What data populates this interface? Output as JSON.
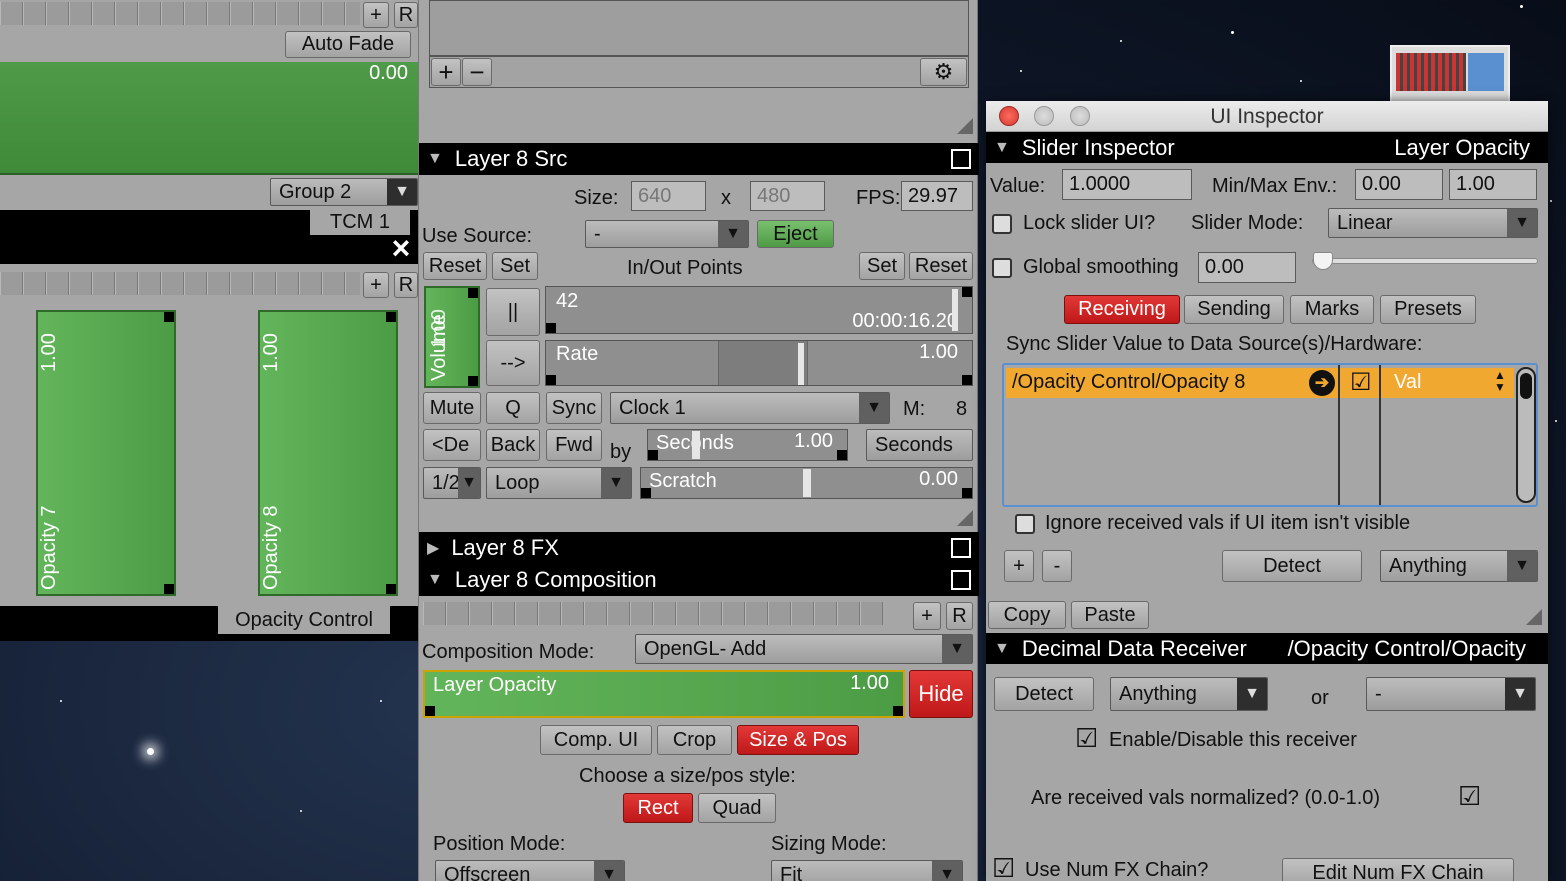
{
  "left_panel": {
    "add_button": "+",
    "r_button": "R",
    "auto_fade_button": "Auto Fade",
    "fade_value": "0.00",
    "group_select": "Group 2",
    "tcm_label": "TCM 1",
    "close_icon": "×",
    "opacity7": {
      "value": "1.00",
      "label": "Opacity 7"
    },
    "opacity8": {
      "value": "1.00",
      "label": "Opacity 8"
    },
    "opacity_control_label": "Opacity Control"
  },
  "mid_panel": {
    "top_plus": "+",
    "top_minus": "−",
    "gear_icon": "⚙",
    "src_header": "Layer 8 Src",
    "size_label": "Size:",
    "size_w": "640",
    "size_x": "x",
    "size_h": "480",
    "fps_label": "FPS:",
    "fps_value": "29.97",
    "use_source_label": "Use Source:",
    "source_value": "-",
    "eject_button": "Eject",
    "reset_left": "Reset",
    "set_left": "Set",
    "in_out_label": "In/Out Points",
    "set_right": "Set",
    "reset_right": "Reset",
    "volume_label": "Volume",
    "volume_value": "1.00",
    "pause_button": "||",
    "forward_button": "-->",
    "frame_value": "42",
    "timecode": "00:00:16.20",
    "rate_label": "Rate",
    "rate_value": "1.00",
    "mute_button": "Mute",
    "q_button": "Q",
    "sync_button": "Sync",
    "clock_select": "Clock 1",
    "m_label": "M:",
    "m_value": "8",
    "del_button": "<De",
    "back_button": "Back",
    "fwd_button": "Fwd",
    "by_label": "by",
    "seconds_slider_label": "Seconds",
    "seconds_slider_value": "1.00",
    "seconds_select": "Seconds",
    "half_select": "1/2",
    "loop_select": "Loop",
    "scratch_label": "Scratch",
    "scratch_value": "0.00",
    "fx_header": "Layer 8 FX",
    "comp_header": "Layer 8 Composition",
    "comp_plus": "+",
    "comp_r": "R",
    "composition_mode_label": "Composition Mode:",
    "composition_mode_value": "OpenGL- Add",
    "layer_opacity_label": "Layer Opacity",
    "layer_opacity_value": "1.00",
    "hide_button": "Hide",
    "comp_ui_button": "Comp. UI",
    "crop_button": "Crop",
    "size_pos_button": "Size & Pos",
    "choose_style_label": "Choose a size/pos style:",
    "rect_button": "Rect",
    "quad_button": "Quad",
    "position_mode_label": "Position Mode:",
    "position_mode_value": "Offscreen",
    "sizing_mode_label": "Sizing Mode:",
    "sizing_mode_value": "Fit"
  },
  "inspector": {
    "window_title": "UI Inspector",
    "slider_header": "Slider Inspector",
    "slider_target": "Layer Opacity",
    "value_label": "Value:",
    "value": "1.0000",
    "minmax_label": "Min/Max Env.:",
    "min_value": "0.00",
    "max_value": "1.00",
    "lock_label": "Lock slider UI?",
    "slider_mode_label": "Slider Mode:",
    "slider_mode_value": "Linear",
    "smoothing_label": "Global smoothing",
    "smoothing_value": "0.00",
    "tabs": [
      "Receiving",
      "Sending",
      "Marks",
      "Presets"
    ],
    "sync_label": "Sync Slider Value to Data Source(s)/Hardware:",
    "source_row": {
      "path": "/Opacity Control/Opacity 8",
      "checked": "☑",
      "mode": "Val"
    },
    "ignore_label": "Ignore received vals if UI item isn't visible",
    "add_button": "+",
    "remove_button": "-",
    "detect_button": "Detect",
    "anything_select": "Anything",
    "copy_button": "Copy",
    "paste_button": "Paste",
    "receiver_header": "Decimal Data Receiver",
    "receiver_target": "/Opacity Control/Opacity",
    "detect2_button": "Detect",
    "anything2_select": "Anything",
    "or_label": "or",
    "dash_select": "-",
    "enable_label": "Enable/Disable this receiver",
    "normalized_label": "Are received vals normalized? (0.0-1.0)",
    "num_fx_label": "Use Num FX Chain?",
    "edit_fx_button": "Edit Num FX Chain"
  }
}
